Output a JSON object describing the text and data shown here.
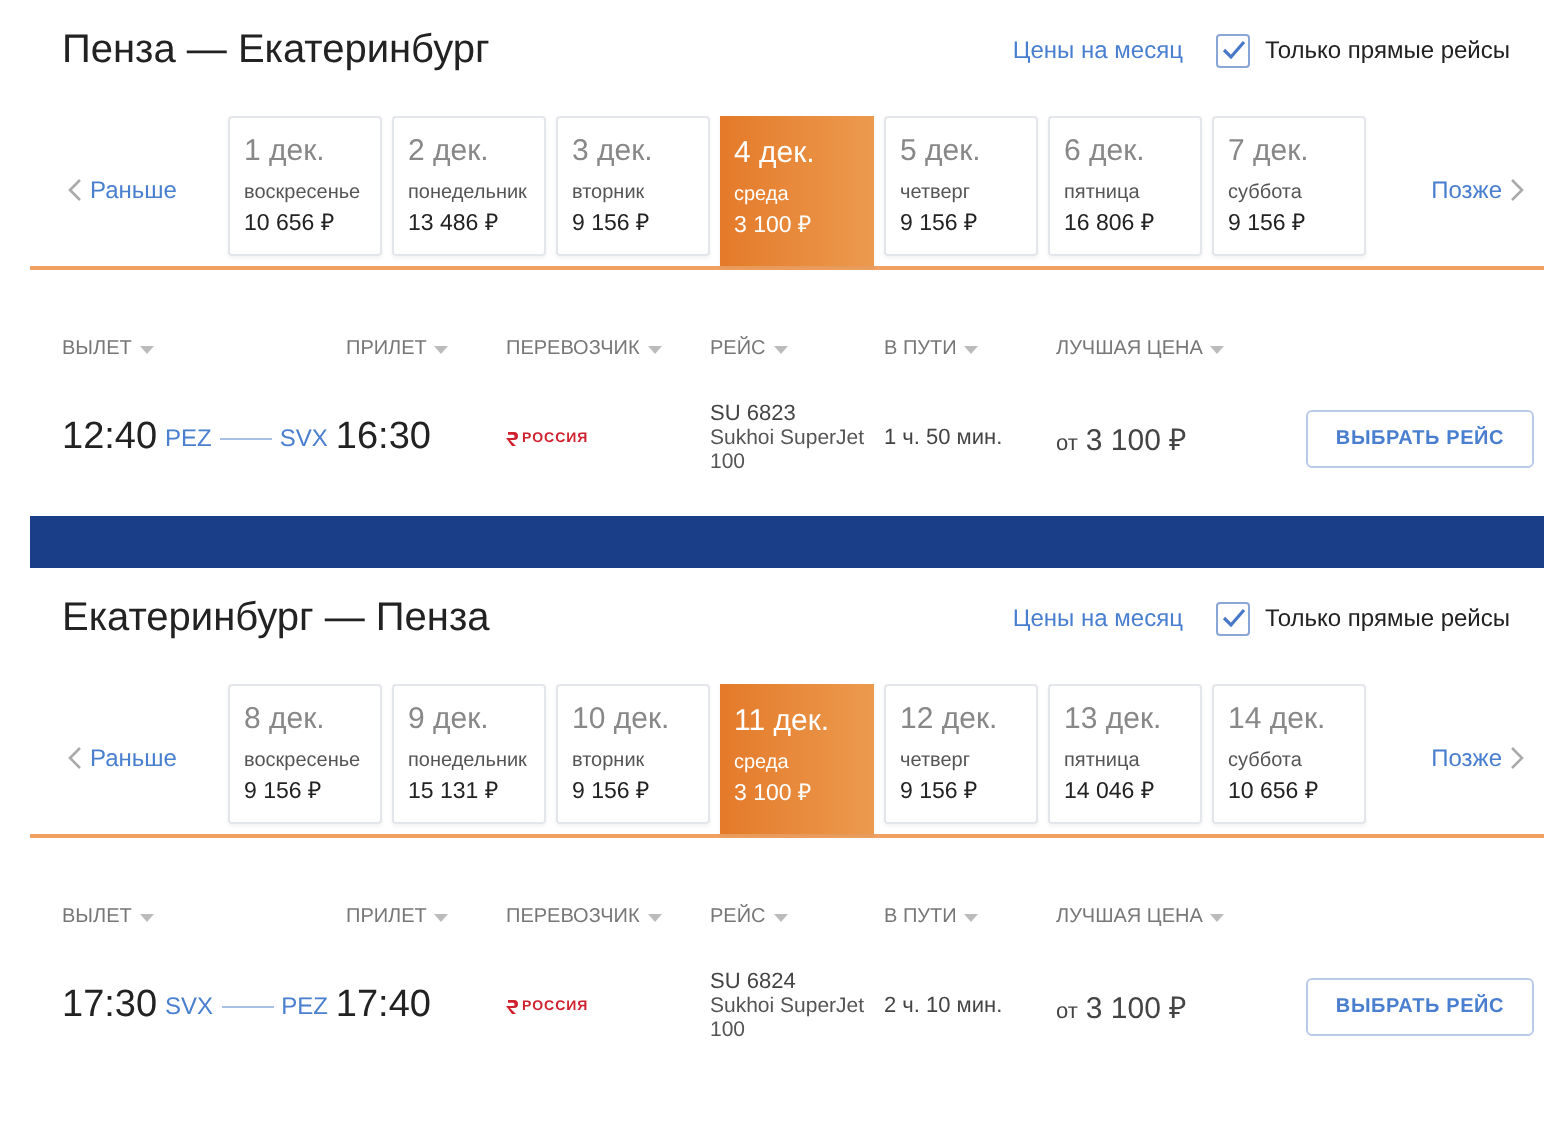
{
  "sections": [
    {
      "title": "Пенза — Екатеринбург",
      "month_prices_link": "Цены на месяц",
      "direct_only": {
        "label": "Только прямые рейсы",
        "checked": true
      },
      "earlier": "Раньше",
      "later": "Позже",
      "dates": [
        {
          "date": "1 дек.",
          "weekday": "воскресенье",
          "price": "10 656 ₽",
          "selected": false
        },
        {
          "date": "2 дек.",
          "weekday": "понедельник",
          "price": "13 486 ₽",
          "selected": false
        },
        {
          "date": "3 дек.",
          "weekday": "вторник",
          "price": "9 156 ₽",
          "selected": false
        },
        {
          "date": "4 дек.",
          "weekday": "среда",
          "price": "3 100 ₽",
          "selected": true
        },
        {
          "date": "5 дек.",
          "weekday": "четверг",
          "price": "9 156 ₽",
          "selected": false
        },
        {
          "date": "6 дек.",
          "weekday": "пятница",
          "price": "16 806 ₽",
          "selected": false
        },
        {
          "date": "7 дек.",
          "weekday": "суббота",
          "price": "9 156 ₽",
          "selected": false
        }
      ],
      "columns": [
        "ВЫЛЕТ",
        "ПРИЛЕТ",
        "ПЕРЕВОЗЧИК",
        "РЕЙС",
        "В ПУТИ",
        "ЛУЧШАЯ ЦЕНА"
      ],
      "flight": {
        "departure": "12:40",
        "from": "PEZ",
        "to": "SVX",
        "arrival": "16:30",
        "carrier": "РОССИЯ",
        "number": "SU 6823",
        "aircraft": "Sukhoi SuperJet 100",
        "duration": "1 ч. 50 мин.",
        "price_prefix": "от",
        "price": "3 100 ₽",
        "button": "ВЫБРАТЬ РЕЙС"
      }
    },
    {
      "title": "Екатеринбург — Пенза",
      "month_prices_link": "Цены на месяц",
      "direct_only": {
        "label": "Только прямые рейсы",
        "checked": true
      },
      "earlier": "Раньше",
      "later": "Позже",
      "dates": [
        {
          "date": "8 дек.",
          "weekday": "воскресенье",
          "price": "9 156 ₽",
          "selected": false
        },
        {
          "date": "9 дек.",
          "weekday": "понедельник",
          "price": "15 131 ₽",
          "selected": false
        },
        {
          "date": "10 дек.",
          "weekday": "вторник",
          "price": "9 156 ₽",
          "selected": false
        },
        {
          "date": "11 дек.",
          "weekday": "среда",
          "price": "3 100 ₽",
          "selected": true
        },
        {
          "date": "12 дек.",
          "weekday": "четверг",
          "price": "9 156 ₽",
          "selected": false
        },
        {
          "date": "13 дек.",
          "weekday": "пятница",
          "price": "14 046 ₽",
          "selected": false
        },
        {
          "date": "14 дек.",
          "weekday": "суббота",
          "price": "10 656 ₽",
          "selected": false
        }
      ],
      "columns": [
        "ВЫЛЕТ",
        "ПРИЛЕТ",
        "ПЕРЕВОЗЧИК",
        "РЕЙС",
        "В ПУТИ",
        "ЛУЧШАЯ ЦЕНА"
      ],
      "flight": {
        "departure": "17:30",
        "from": "SVX",
        "to": "PEZ",
        "arrival": "17:40",
        "carrier": "РОССИЯ",
        "number": "SU 6824",
        "aircraft": "Sukhoi SuperJet 100",
        "duration": "2 ч. 10 мин.",
        "price_prefix": "от",
        "price": "3 100 ₽",
        "button": "ВЫБРАТЬ РЕЙС"
      }
    }
  ]
}
